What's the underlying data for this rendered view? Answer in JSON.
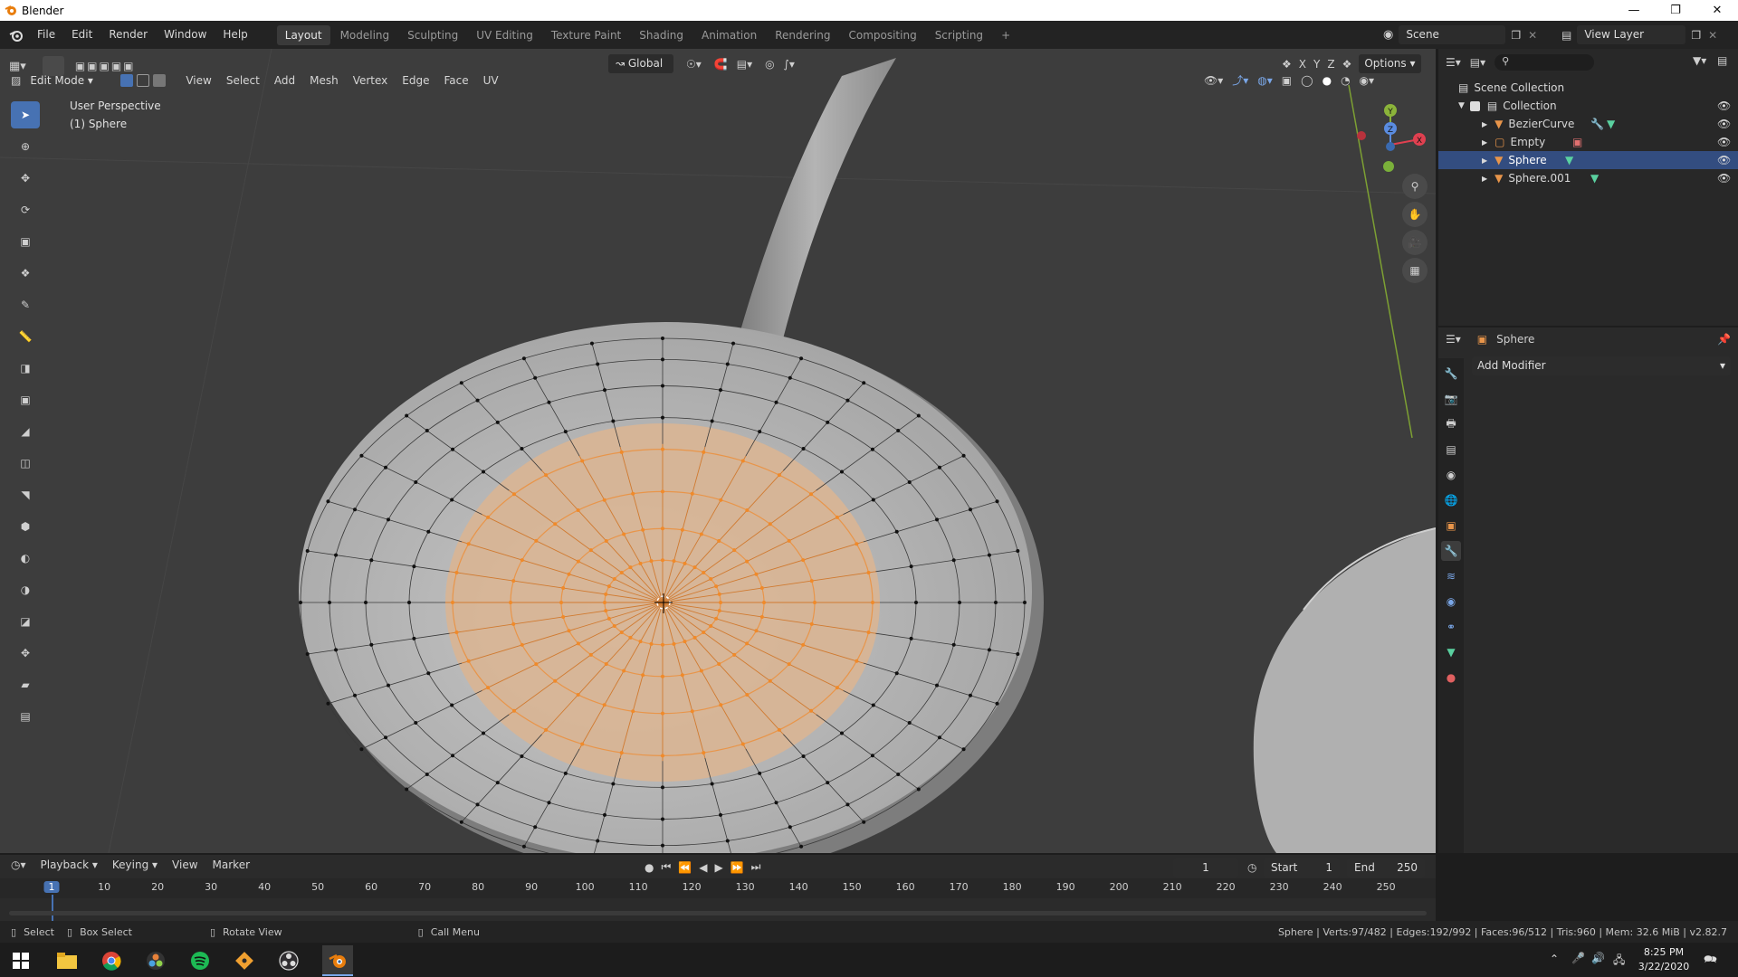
{
  "window": {
    "title": "Blender"
  },
  "menus": [
    "File",
    "Edit",
    "Render",
    "Window",
    "Help"
  ],
  "workspaces": [
    {
      "label": "Layout",
      "active": true
    },
    {
      "label": "Modeling",
      "active": false
    },
    {
      "label": "Sculpting",
      "active": false
    },
    {
      "label": "UV Editing",
      "active": false
    },
    {
      "label": "Texture Paint",
      "active": false
    },
    {
      "label": "Shading",
      "active": false
    },
    {
      "label": "Animation",
      "active": false
    },
    {
      "label": "Rendering",
      "active": false
    },
    {
      "label": "Compositing",
      "active": false
    },
    {
      "label": "Scripting",
      "active": false
    }
  ],
  "add_workspace": "+",
  "scene": {
    "name": "Scene",
    "view_layer": "View Layer"
  },
  "viewport": {
    "mode": "Edit Mode",
    "menus": [
      "View",
      "Select",
      "Add",
      "Mesh",
      "Vertex",
      "Edge",
      "Face",
      "UV"
    ],
    "transform": "Global",
    "options": "Options",
    "perspective": "User Perspective",
    "active_object": "(1) Sphere",
    "axes": {
      "x": "X",
      "y": "Y",
      "z": "Z"
    }
  },
  "outliner": {
    "root": "Scene Collection",
    "collection": "Collection",
    "items": [
      {
        "name": "BezierCurve",
        "selected": false
      },
      {
        "name": "Empty",
        "selected": false
      },
      {
        "name": "Sphere",
        "selected": true
      },
      {
        "name": "Sphere.001",
        "selected": false
      }
    ]
  },
  "properties": {
    "object": "Sphere",
    "add_modifier": "Add Modifier"
  },
  "timeline": {
    "menus": [
      "Playback",
      "Keying",
      "View",
      "Marker"
    ],
    "current_frame": "1",
    "start_label": "Start",
    "start": "1",
    "end_label": "End",
    "end": "250",
    "ticks": [
      "1",
      "10",
      "20",
      "30",
      "40",
      "50",
      "60",
      "70",
      "80",
      "90",
      "100",
      "110",
      "120",
      "130",
      "140",
      "150",
      "160",
      "170",
      "180",
      "190",
      "200",
      "210",
      "220",
      "230",
      "240",
      "250"
    ]
  },
  "statusbar": {
    "select": "Select",
    "box_select": "Box Select",
    "rotate_view": "Rotate View",
    "call_menu": "Call Menu",
    "stats": "Sphere | Verts:97/482 | Edges:192/992 | Faces:96/512 | Tris:960 | Mem: 32.6 MiB | v2.82.7"
  },
  "taskbar": {
    "time": "8:25 PM",
    "date": "3/22/2020"
  },
  "colors": {
    "accent": "#4772b3",
    "selection_orange": "#e8954a",
    "bg": "#3d3d3d"
  }
}
